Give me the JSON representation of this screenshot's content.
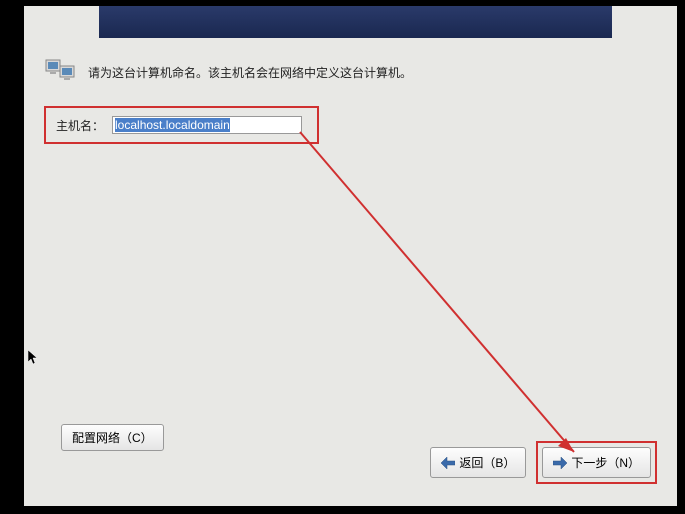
{
  "instruction": "请为这台计算机命名。该主机名会在网络中定义这台计算机。",
  "hostname": {
    "label": "主机名：",
    "value": "localhost.localdomain"
  },
  "buttons": {
    "configNetwork": "配置网络（C）",
    "back": "返回（B）",
    "next": "下一步（N）"
  },
  "icons": {
    "computer": "computer-icon",
    "arrowLeft": "arrow-left-icon",
    "arrowRight": "arrow-right-icon"
  }
}
